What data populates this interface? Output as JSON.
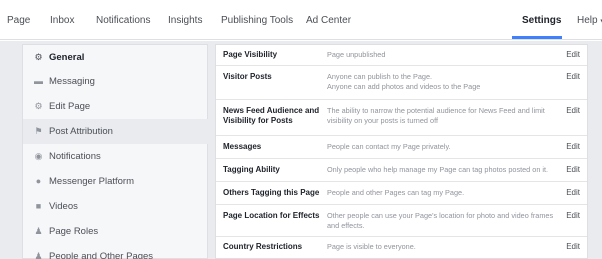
{
  "nav": {
    "items": [
      "Page",
      "Inbox",
      "Notifications",
      "Insights",
      "Publishing Tools",
      "Ad Center"
    ],
    "settings": "Settings",
    "help": "Help",
    "help_caret": "▾"
  },
  "sidebar": {
    "items": [
      {
        "label": "General",
        "icon": "gear-icon",
        "glyph": "⚙"
      },
      {
        "label": "Messaging",
        "icon": "messaging-icon",
        "glyph": "▬"
      },
      {
        "label": "Edit Page",
        "icon": "gear-icon",
        "glyph": "⚙"
      },
      {
        "label": "Post Attribution",
        "icon": "flag-icon",
        "glyph": "⚑"
      },
      {
        "label": "Notifications",
        "icon": "globe-icon",
        "glyph": "◉"
      },
      {
        "label": "Messenger Platform",
        "icon": "messenger-icon",
        "glyph": "●"
      },
      {
        "label": "Videos",
        "icon": "video-camera-icon",
        "glyph": "■"
      },
      {
        "label": "Page Roles",
        "icon": "person-icon",
        "glyph": "♟"
      },
      {
        "label": "People and Other Pages",
        "icon": "people-icon",
        "glyph": "♟"
      }
    ]
  },
  "settings": {
    "edit_label": "Edit",
    "rows": [
      {
        "label": "Page Visibility",
        "value": "Page unpublished"
      },
      {
        "label": "Visitor Posts",
        "value": "Anyone can publish to the Page.",
        "value2": "Anyone can add photos and videos to the Page"
      },
      {
        "label": "News Feed Audience and Visibility for Posts",
        "value": "The ability to narrow the potential audience for News Feed and limit visibility on your posts is turned off"
      },
      {
        "label": "Messages",
        "value": "People can contact my Page privately."
      },
      {
        "label": "Tagging Ability",
        "value": "Only people who help manage my Page can tag photos posted on it."
      },
      {
        "label": "Others Tagging this Page",
        "value": "People and other Pages can tag my Page."
      },
      {
        "label": "Page Location for Effects",
        "value": "Other people can use your Page's location for photo and video frames and effects."
      },
      {
        "label": "Country Restrictions",
        "value": "Page is visible to everyone."
      }
    ]
  }
}
